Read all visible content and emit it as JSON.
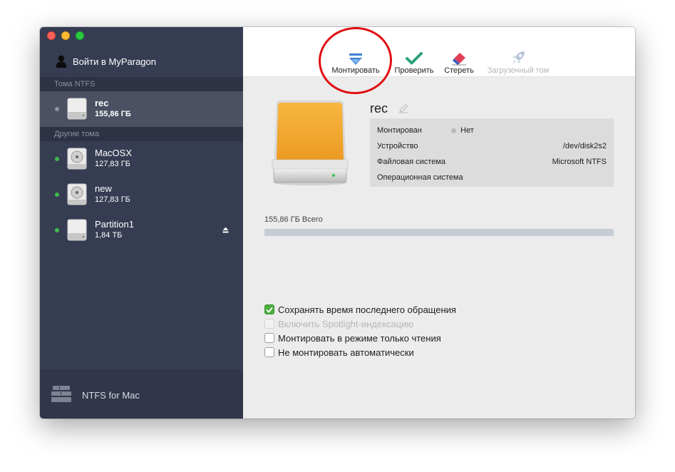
{
  "sidebar": {
    "login_label": "Войти в MyParagon",
    "ntfs_header": "Тома NTFS",
    "other_header": "Другие тома",
    "ntfs_volumes": [
      {
        "name": "rec",
        "size": "155,86 ГБ",
        "mounted": false,
        "selected": true
      }
    ],
    "other_volumes": [
      {
        "name": "MacOSX",
        "size": "127,83 ГБ",
        "mounted": true
      },
      {
        "name": "new",
        "size": "127,83 ГБ",
        "mounted": true
      },
      {
        "name": "Partition1",
        "size": "1,84 ТБ",
        "mounted": true,
        "ejectable": true
      }
    ],
    "footer_label": "NTFS for Mac"
  },
  "toolbar": {
    "mount_label": "Монтировать",
    "verify_label": "Проверить",
    "erase_label": "Стереть",
    "boot_label": "Загрузочный том"
  },
  "volume": {
    "name": "rec",
    "info": {
      "mounted_label": "Монтирован",
      "mounted_value": "Нет",
      "device_label": "Устройство",
      "device_value": "/dev/disk2s2",
      "fs_label": "Файловая система",
      "fs_value": "Microsoft NTFS",
      "os_label": "Операционная система",
      "os_value": ""
    },
    "total_label": "155,86 ГБ Всего",
    "used_fraction": 0.0
  },
  "options": [
    {
      "label": "Сохранять время последнего обращения",
      "checked": true,
      "enabled": true
    },
    {
      "label": "Включить Spotlight-индексацию",
      "checked": false,
      "enabled": false
    },
    {
      "label": "Монтировать в режиме только чтения",
      "checked": false,
      "enabled": true
    },
    {
      "label": "Не монтировать автоматически",
      "checked": false,
      "enabled": true
    }
  ],
  "colors": {
    "sidebar_bg": "#363c52",
    "selected_row": "#4b5063",
    "mounted_dot": "#3dbb4e",
    "unmounted_dot": "#8d92a0",
    "checkbox_on": "#4caf3f",
    "annotation": "#e10d14"
  }
}
